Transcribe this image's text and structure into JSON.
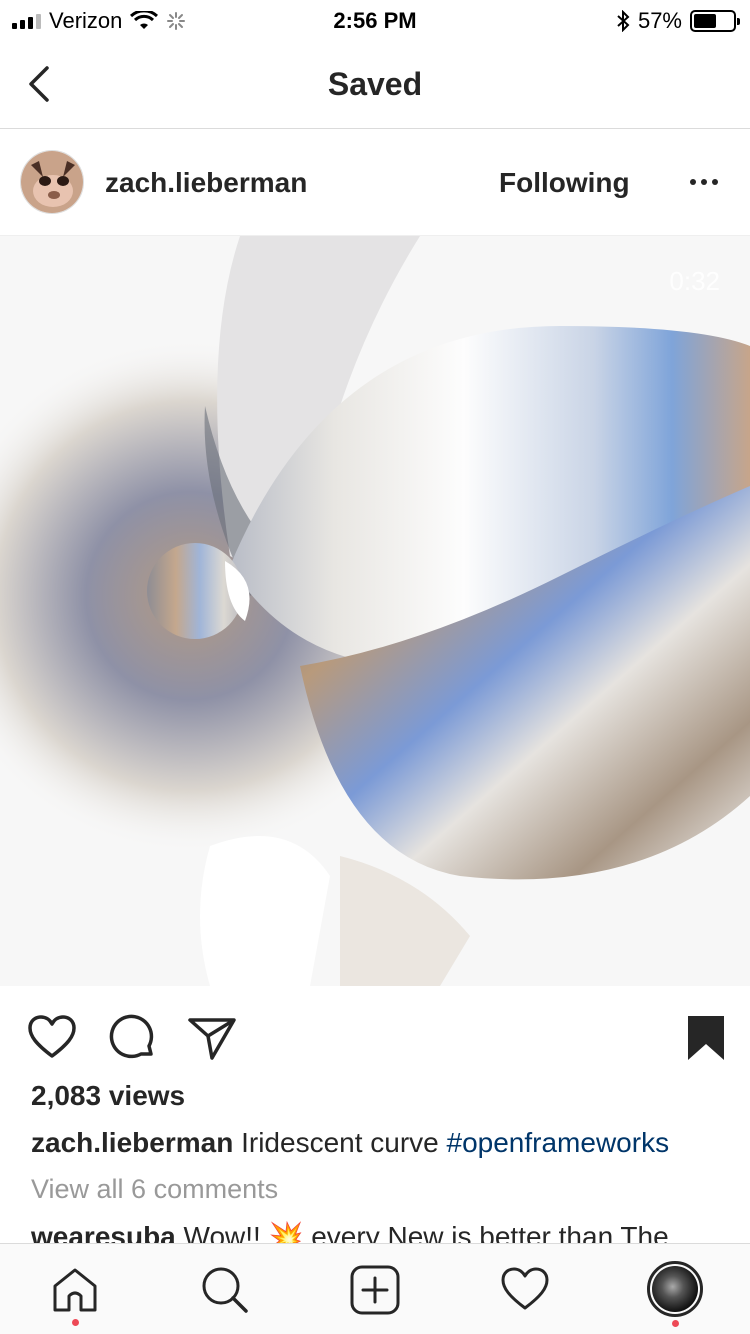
{
  "status_bar": {
    "carrier": "Verizon",
    "time": "2:56 PM",
    "battery": "57%",
    "battery_level": 0.57
  },
  "nav": {
    "title": "Saved",
    "back_icon": "chevron-left-icon"
  },
  "post": {
    "username": "zach.lieberman",
    "follow_label": "Following",
    "more_icon": "ellipsis-icon",
    "video_duration": "0:32",
    "views": "2,083 views",
    "caption_user": "zach.lieberman",
    "caption_text": "Iridescent curve",
    "caption_tag": "#openframeworks",
    "view_all": "View all 6 comments",
    "comment_user": "wearesuba",
    "comment_text": "Wow!! 💥 every New is better than The"
  },
  "actions": {
    "like_icon": "heart-icon",
    "comment_icon": "comment-icon",
    "share_icon": "paper-plane-icon",
    "save_icon": "bookmark-filled-icon"
  },
  "tabbar": {
    "items": [
      "home-icon",
      "search-icon",
      "add-icon",
      "activity-heart-icon",
      "profile-avatar"
    ]
  }
}
